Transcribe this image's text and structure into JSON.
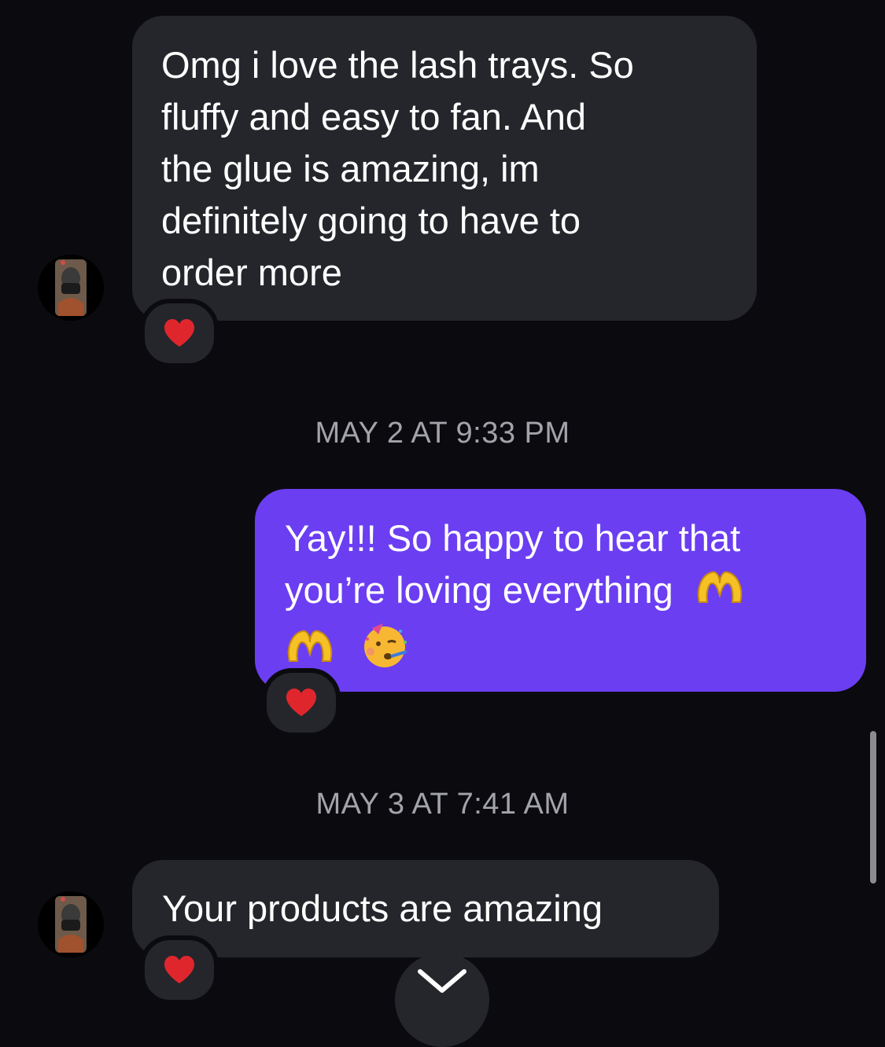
{
  "messages": [
    {
      "direction": "incoming",
      "lines": [
        "Omg i love the lash trays. So",
        "fluffy and easy to fan. And",
        "the glue is amazing, im",
        "definitely going to have to",
        "order more"
      ],
      "reaction": "red-heart"
    },
    {
      "timestamp": "MAY 2 AT 9:33 PM"
    },
    {
      "direction": "outgoing",
      "lines": [
        "Yay!!! So happy to hear that",
        "you’re loving everything"
      ],
      "emojis": [
        "heart-hands",
        "heart-hands",
        "partying-face"
      ],
      "reaction": "red-heart"
    },
    {
      "timestamp": "MAY 3 AT 7:41 AM"
    },
    {
      "direction": "incoming",
      "lines": [
        "Your products are amazing"
      ],
      "reaction": "red-heart"
    }
  ],
  "colors": {
    "background": "#0b0b0f",
    "incoming_bubble": "#25262b",
    "outgoing_bubble": "#6b3ef2",
    "timestamp_text": "#a3a4aa",
    "reaction_heart": "#e0262d"
  },
  "icons": {
    "reaction": "red-heart-icon",
    "scroll_down": "chevron-down-icon"
  }
}
